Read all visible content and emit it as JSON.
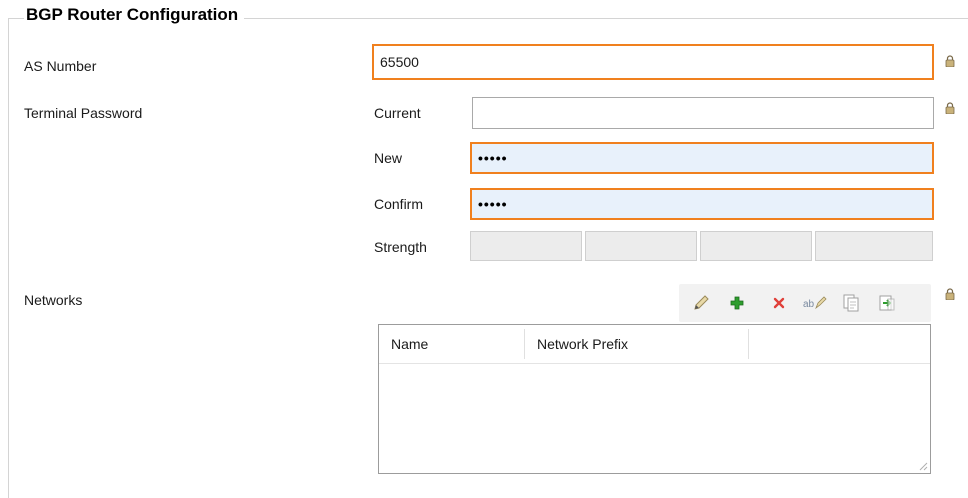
{
  "section": {
    "title": "BGP Router Configuration"
  },
  "as_number": {
    "label": "AS Number",
    "value": "65500"
  },
  "terminal_password": {
    "label": "Terminal Password",
    "current_label": "Current",
    "current_value": "",
    "new_label": "New",
    "new_value": "•••••",
    "confirm_label": "Confirm",
    "confirm_value": "•••••",
    "strength_label": "Strength"
  },
  "networks": {
    "label": "Networks",
    "toolbar": [
      "edit-icon",
      "add-icon",
      "delete-icon",
      "rename-icon",
      "copy-icon",
      "paste-icon"
    ],
    "columns": [
      "Name",
      "Network Prefix",
      ""
    ],
    "rows": []
  },
  "colors": {
    "required_border": "#f0801e",
    "password_fill": "#e8f1fb",
    "add_green": "#2e9e2e",
    "delete_red": "#e0403a"
  }
}
